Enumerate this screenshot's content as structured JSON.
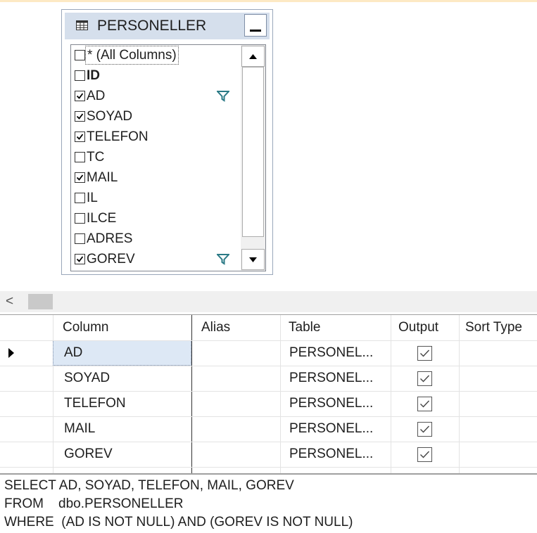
{
  "table": {
    "name": "PERSONELLER",
    "columns": [
      {
        "label": "* (All Columns)",
        "checked": false,
        "bold": false,
        "filter": false
      },
      {
        "label": "ID",
        "checked": false,
        "bold": true,
        "filter": false
      },
      {
        "label": "AD",
        "checked": true,
        "bold": false,
        "filter": true
      },
      {
        "label": "SOYAD",
        "checked": true,
        "bold": false,
        "filter": false
      },
      {
        "label": "TELEFON",
        "checked": true,
        "bold": false,
        "filter": false
      },
      {
        "label": "TC",
        "checked": false,
        "bold": false,
        "filter": false
      },
      {
        "label": "MAIL",
        "checked": true,
        "bold": false,
        "filter": false
      },
      {
        "label": "IL",
        "checked": false,
        "bold": false,
        "filter": false
      },
      {
        "label": "ILCE",
        "checked": false,
        "bold": false,
        "filter": false
      },
      {
        "label": "ADRES",
        "checked": false,
        "bold": false,
        "filter": false
      },
      {
        "label": "GOREV",
        "checked": true,
        "bold": false,
        "filter": true
      }
    ]
  },
  "hscroll": {
    "left_arrow": "<"
  },
  "grid": {
    "headers": [
      "Column",
      "Alias",
      "Table",
      "Output",
      "Sort Type"
    ],
    "rows": [
      {
        "column": "AD",
        "alias": "",
        "table": "PERSONEL...",
        "output": true
      },
      {
        "column": "SOYAD",
        "alias": "",
        "table": "PERSONEL...",
        "output": true
      },
      {
        "column": "TELEFON",
        "alias": "",
        "table": "PERSONEL...",
        "output": true
      },
      {
        "column": "MAIL",
        "alias": "",
        "table": "PERSONEL...",
        "output": true
      },
      {
        "column": "GOREV",
        "alias": "",
        "table": "PERSONEL...",
        "output": true
      }
    ]
  },
  "sql": {
    "line1": "SELECT AD, SOYAD, TELEFON, MAIL, GOREV",
    "line2": "FROM    dbo.PERSONELLER",
    "line3": "WHERE  (AD IS NOT NULL) AND (GOREV IS NOT NULL)"
  },
  "colors": {
    "title_bg": "#d5dfec",
    "selected_cell": "#dde8f5",
    "filter_icon": "#2b7a86"
  }
}
